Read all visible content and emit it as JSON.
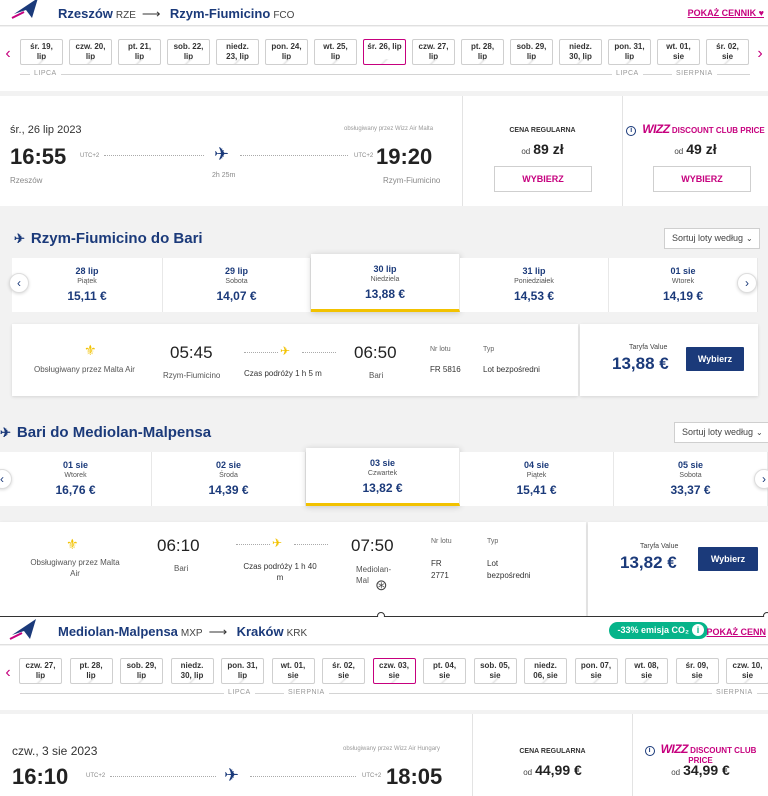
{
  "trip1": {
    "from_city": "Rzeszów",
    "from_code": "RZE",
    "to_city": "Rzym-Fiumicino",
    "to_code": "FCO",
    "price_link": "POKAŻ CENNIK"
  },
  "dates1": {
    "tiles": [
      {
        "l1": "śr. 19,",
        "l2": "lip"
      },
      {
        "l1": "czw. 20,",
        "l2": "lip"
      },
      {
        "l1": "pt. 21,",
        "l2": "lip"
      },
      {
        "l1": "sob. 22,",
        "l2": "lip"
      },
      {
        "l1": "niedz.",
        "l2": "23, lip"
      },
      {
        "l1": "pon. 24,",
        "l2": "lip"
      },
      {
        "l1": "wt. 25,",
        "l2": "lip"
      },
      {
        "l1": "śr. 26, lip",
        "l2": ""
      },
      {
        "l1": "czw. 27,",
        "l2": "lip"
      },
      {
        "l1": "pt. 28,",
        "l2": "lip"
      },
      {
        "l1": "sob. 29,",
        "l2": "lip"
      },
      {
        "l1": "niedz.",
        "l2": "30, lip"
      },
      {
        "l1": "pon. 31,",
        "l2": "lip"
      },
      {
        "l1": "wt. 01,",
        "l2": "sie"
      },
      {
        "l1": "śr. 02,",
        "l2": "sie"
      }
    ],
    "month_left": "LIPCA",
    "month_mid": "LIPCA",
    "month_right": "SIERPNIA"
  },
  "flight1": {
    "date": "śr., 26 lip 2023",
    "operated_by": "obsługiwany przez Wizz Air Malta",
    "dep_time": "16:55",
    "dep_utc": "UTC+2",
    "arr_time": "19:20",
    "arr_utc": "UTC+2",
    "duration": "2h 25m",
    "from": "Rzeszów",
    "to": "Rzym-Fiumicino",
    "regular_title": "CENA REGULARNA",
    "regular_od": "od",
    "regular_price": "89 zł",
    "club_wizz": "WIZZ",
    "club_text": "DISCOUNT CLUB PRICE",
    "club_od": "od",
    "club_price": "49 zł",
    "select_label": "WYBIERZ"
  },
  "conn1": {
    "title": "Rzym-Fiumicino do Bari",
    "sort_label": "Sortuj loty według",
    "days": [
      {
        "d": "28 lip",
        "w": "Piątek",
        "p": "15,11 €"
      },
      {
        "d": "29 lip",
        "w": "Sobota",
        "p": "14,07 €"
      },
      {
        "d": "30 lip",
        "w": "Niedziela",
        "p": "13,88 €"
      },
      {
        "d": "31 lip",
        "w": "Poniedziałek",
        "p": "14,53 €"
      },
      {
        "d": "01 sie",
        "w": "Wtorek",
        "p": "14,19 €"
      }
    ],
    "operator": "Obsługiwany przez Malta Air",
    "dep_time": "05:45",
    "dep_city": "Rzym-Fiumicino",
    "duration": "Czas podróży 1 h 5 m",
    "arr_time": "06:50",
    "arr_city": "Bari",
    "flight_no_label": "Nr lotu",
    "flight_no": "FR 5816",
    "type_label": "Typ",
    "type": "Lot bezpośredni",
    "fare_label": "Taryfa Value",
    "fare_price": "13,88 €",
    "select": "Wybierz"
  },
  "conn2": {
    "title": "Bari do Mediolan-Malpensa",
    "sort_label": "Sortuj loty według",
    "days": [
      {
        "d": "01 sie",
        "w": "Wtorek",
        "p": "16,76 €"
      },
      {
        "d": "02 sie",
        "w": "Środa",
        "p": "14,39 €"
      },
      {
        "d": "03 sie",
        "w": "Czwartek",
        "p": "13,82 €"
      },
      {
        "d": "04 sie",
        "w": "Piątek",
        "p": "15,41 €"
      },
      {
        "d": "05 sie",
        "w": "Sobota",
        "p": "33,37 €"
      }
    ],
    "operator_l1": "Obsługiwany przez Malta",
    "operator_l2": "Air",
    "dep_time": "06:10",
    "dep_city": "Bari",
    "duration_l1": "Czas podróży 1 h 40",
    "duration_l2": "m",
    "arr_time": "07:50",
    "arr_city_l1": "Mediolan-",
    "arr_city_l2": "Mal",
    "flight_no_label": "Nr lotu",
    "flight_no_l1": "FR",
    "flight_no_l2": "2771",
    "type_label": "Typ",
    "type_l1": "Lot",
    "type_l2": "bezpośredni",
    "fare_label": "Taryfa Value",
    "fare_price": "13,82 €",
    "select": "Wybierz"
  },
  "trip2": {
    "from_city": "Mediolan-Malpensa",
    "from_code": "MXP",
    "to_city": "Kraków",
    "to_code": "KRK",
    "emission": "-33% emisja CO₂",
    "price_link": "POKAŻ CENN"
  },
  "dates2": {
    "tiles": [
      {
        "l1": "czw. 27,",
        "l2": "lip"
      },
      {
        "l1": "pt. 28,",
        "l2": "lip"
      },
      {
        "l1": "sob. 29,",
        "l2": "lip"
      },
      {
        "l1": "niedz.",
        "l2": "30, lip"
      },
      {
        "l1": "pon. 31,",
        "l2": "lip"
      },
      {
        "l1": "wt. 01,",
        "l2": "sie"
      },
      {
        "l1": "śr. 02,",
        "l2": "sie"
      },
      {
        "l1": "czw. 03,",
        "l2": "sie"
      },
      {
        "l1": "pt. 04,",
        "l2": "sie"
      },
      {
        "l1": "sob. 05,",
        "l2": "sie"
      },
      {
        "l1": "niedz.",
        "l2": "06, sie"
      },
      {
        "l1": "pon. 07,",
        "l2": "sie"
      },
      {
        "l1": "wt. 08,",
        "l2": "sie"
      },
      {
        "l1": "śr. 09,",
        "l2": "sie"
      },
      {
        "l1": "czw. 10,",
        "l2": "sie"
      }
    ],
    "month_left": "LIPCA",
    "month_right1": "SIERPNIA",
    "month_right2": "SIERPNIA"
  },
  "flight2": {
    "date": "czw., 3 sie 2023",
    "operated_by": "obsługiwany przez Wizz Air Hungary",
    "dep_time": "16:10",
    "dep_utc": "UTC+2",
    "arr_time": "18:05",
    "arr_utc": "UTC+2",
    "regular_title": "CENA REGULARNA",
    "regular_od": "od",
    "regular_price": "44,99 €",
    "club_wizz": "WIZZ",
    "club_text": "DISCOUNT CLUB PRICE",
    "club_od": "od",
    "club_price": "34,99 €"
  }
}
